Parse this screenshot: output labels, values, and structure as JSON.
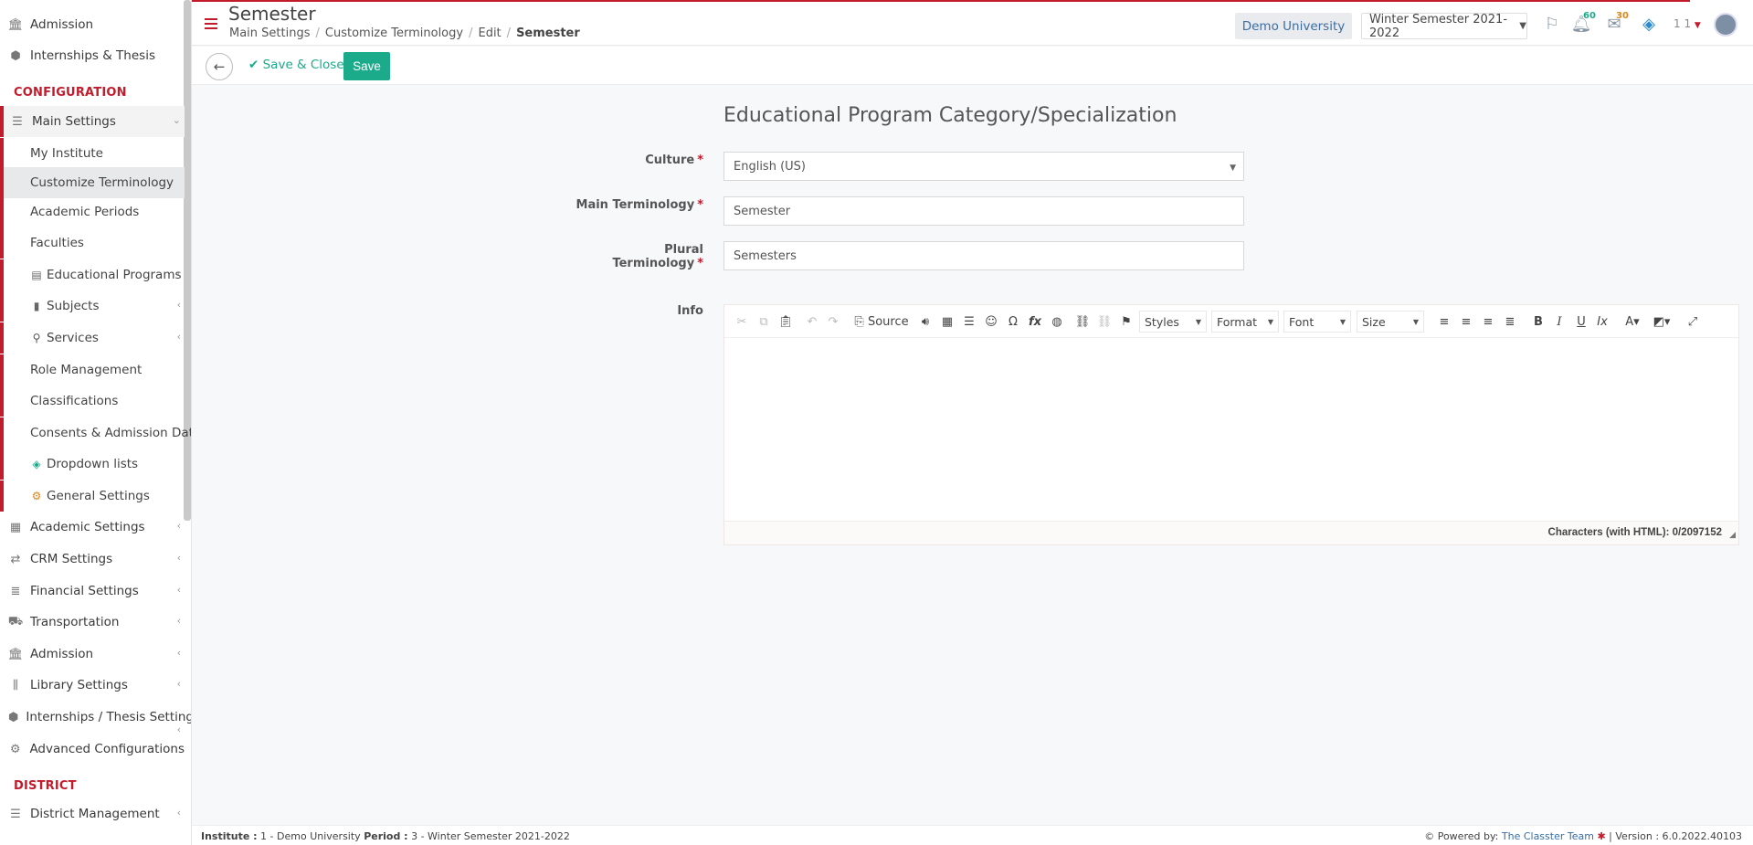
{
  "sidebar": {
    "top_items": [
      {
        "label": "Admission",
        "icon": "bank-icon"
      },
      {
        "label": "Internships & Thesis",
        "icon": "cube-icon"
      }
    ],
    "config_section": "CONFIGURATION",
    "main_settings": "Main Settings",
    "sub_items": [
      {
        "label": "My Institute"
      },
      {
        "label": "Customize Terminology"
      },
      {
        "label": "Academic Periods"
      },
      {
        "label": "Faculties"
      },
      {
        "label": "Educational Programs"
      },
      {
        "label": "Subjects"
      },
      {
        "label": "Services"
      },
      {
        "label": "Role Management"
      },
      {
        "label": "Classifications"
      },
      {
        "label": "Consents & Admission Data"
      },
      {
        "label": "Dropdown lists"
      },
      {
        "label": "General Settings"
      }
    ],
    "config_items": [
      {
        "label": "Academic Settings"
      },
      {
        "label": "CRM Settings"
      },
      {
        "label": "Financial Settings"
      },
      {
        "label": "Transportation"
      },
      {
        "label": "Admission"
      },
      {
        "label": "Library Settings"
      },
      {
        "label": "Internships / Thesis Settings"
      },
      {
        "label": "Advanced Configurations"
      }
    ],
    "district_section": "DISTRICT",
    "district_items": [
      {
        "label": "District Management"
      }
    ]
  },
  "header": {
    "title": "Semester",
    "breadcrumbs": [
      "Main Settings",
      "Customize Terminology",
      "Edit",
      "Semester"
    ],
    "university": "Demo University",
    "period": "Winter Semester 2021-2022",
    "notifications_count": "60",
    "messages_count": "30",
    "user_count": "1 1"
  },
  "actions": {
    "save_close": "Save & Close",
    "save": "Save"
  },
  "form": {
    "title": "Educational Program Category/Specialization",
    "culture_label": "Culture",
    "culture_value": "English (US)",
    "main_label": "Main Terminology",
    "main_value": "Semester",
    "plural_label": "Plural Terminology",
    "plural_value": "Semesters",
    "info_label": "Info",
    "required_mark": "*"
  },
  "editor": {
    "source_label": "Source",
    "styles": "Styles",
    "format": "Format",
    "font": "Font",
    "size": "Size",
    "char_count": "Characters (with HTML): 0/2097152"
  },
  "footer": {
    "institute_label": "Institute :",
    "institute_value": "1 - Demo University",
    "period_label": "Period :",
    "period_value": "3 - Winter Semester 2021-2022",
    "powered_by": "Powered by:",
    "team": "The Classter Team",
    "version": "| Version : 6.0.2022.40103"
  },
  "colors": {
    "accent": "#c21c2c",
    "primary": "#1bab8a",
    "link": "#3a6ea5"
  }
}
